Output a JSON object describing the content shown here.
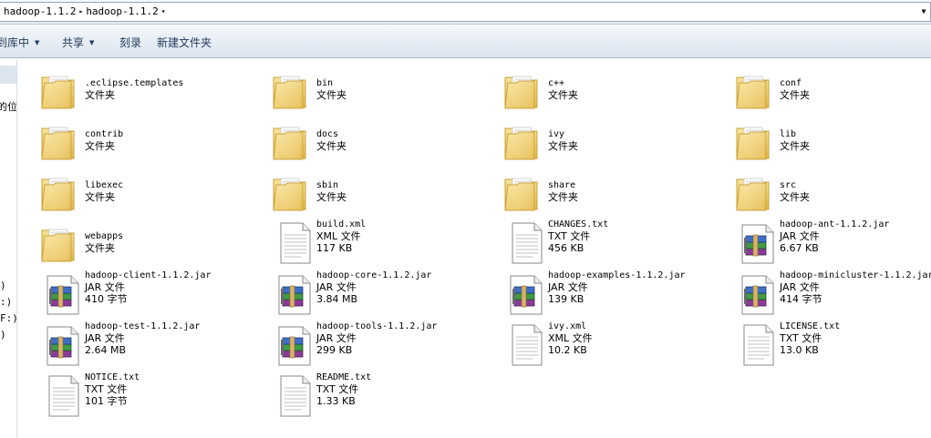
{
  "address": {
    "crumbs": [
      "hadoop-1.1.2",
      "hadoop-1.1.2"
    ]
  },
  "toolbar": {
    "include_library": "包含到库中",
    "share": "共享",
    "burn": "刻录",
    "new_folder": "新建文件夹"
  },
  "navpane": {
    "labels": [
      "的位",
      ")",
      ":)",
      "F:)",
      ")"
    ]
  },
  "items": [
    {
      "name": ".eclipse.templates",
      "type": "文件夹",
      "size": "",
      "icon": "folder-icon"
    },
    {
      "name": "bin",
      "type": "文件夹",
      "size": "",
      "icon": "folder-icon"
    },
    {
      "name": "c++",
      "type": "文件夹",
      "size": "",
      "icon": "folder-icon"
    },
    {
      "name": "conf",
      "type": "文件夹",
      "size": "",
      "icon": "folder-icon"
    },
    {
      "name": "contrib",
      "type": "文件夹",
      "size": "",
      "icon": "folder-icon"
    },
    {
      "name": "docs",
      "type": "文件夹",
      "size": "",
      "icon": "folder-icon"
    },
    {
      "name": "ivy",
      "type": "文件夹",
      "size": "",
      "icon": "folder-icon"
    },
    {
      "name": "lib",
      "type": "文件夹",
      "size": "",
      "icon": "folder-icon"
    },
    {
      "name": "libexec",
      "type": "文件夹",
      "size": "",
      "icon": "folder-icon"
    },
    {
      "name": "sbin",
      "type": "文件夹",
      "size": "",
      "icon": "folder-icon"
    },
    {
      "name": "share",
      "type": "文件夹",
      "size": "",
      "icon": "folder-icon"
    },
    {
      "name": "src",
      "type": "文件夹",
      "size": "",
      "icon": "folder-icon"
    },
    {
      "name": "webapps",
      "type": "文件夹",
      "size": "",
      "icon": "folder-icon"
    },
    {
      "name": "build.xml",
      "type": "XML 文件",
      "size": "117 KB",
      "icon": "document-icon"
    },
    {
      "name": "CHANGES.txt",
      "type": "TXT 文件",
      "size": "456 KB",
      "icon": "document-icon"
    },
    {
      "name": "hadoop-ant-1.1.2.jar",
      "type": "JAR 文件",
      "size": "6.67 KB",
      "icon": "archive-icon"
    },
    {
      "name": "hadoop-client-1.1.2.jar",
      "type": "JAR 文件",
      "size": "410 字节",
      "icon": "archive-icon"
    },
    {
      "name": "hadoop-core-1.1.2.jar",
      "type": "JAR 文件",
      "size": "3.84 MB",
      "icon": "archive-icon"
    },
    {
      "name": "hadoop-examples-1.1.2.jar",
      "type": "JAR 文件",
      "size": "139 KB",
      "icon": "archive-icon"
    },
    {
      "name": "hadoop-minicluster-1.1.2.jar",
      "type": "JAR 文件",
      "size": "414 字节",
      "icon": "archive-icon"
    },
    {
      "name": "hadoop-test-1.1.2.jar",
      "type": "JAR 文件",
      "size": "2.64 MB",
      "icon": "archive-icon"
    },
    {
      "name": "hadoop-tools-1.1.2.jar",
      "type": "JAR 文件",
      "size": "299 KB",
      "icon": "archive-icon"
    },
    {
      "name": "ivy.xml",
      "type": "XML 文件",
      "size": "10.2 KB",
      "icon": "document-icon"
    },
    {
      "name": "LICENSE.txt",
      "type": "TXT 文件",
      "size": "13.0 KB",
      "icon": "document-icon"
    },
    {
      "name": "NOTICE.txt",
      "type": "TXT 文件",
      "size": "101 字节",
      "icon": "document-icon"
    },
    {
      "name": "README.txt",
      "type": "TXT 文件",
      "size": "1.33 KB",
      "icon": "document-icon"
    }
  ]
}
